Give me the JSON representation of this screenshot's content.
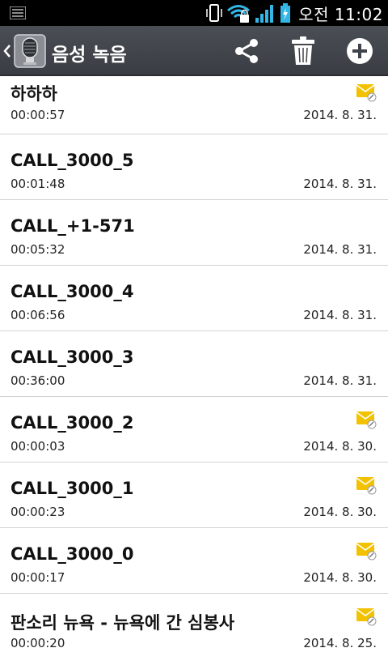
{
  "status_bar": {
    "time": "오전 11:02",
    "icons": [
      "notification-icon",
      "phone-vibrate-icon",
      "wifi-icon",
      "signal-icon",
      "battery-charging-icon"
    ]
  },
  "action_bar": {
    "title": "음성 녹음",
    "icons": [
      "back-chevron-icon",
      "voice-recorder-app-icon",
      "share-icon",
      "trash-icon",
      "add-icon"
    ]
  },
  "recordings": [
    {
      "title": "하하하",
      "duration": "00:00:57",
      "date": "2014. 8. 31.",
      "has_memo": true
    },
    {
      "title": "CALL_3000_5",
      "duration": "00:01:48",
      "date": "2014. 8. 31.",
      "has_memo": false
    },
    {
      "title": "CALL_+1-571",
      "duration": "00:05:32",
      "date": "2014. 8. 31.",
      "has_memo": false
    },
    {
      "title": "CALL_3000_4",
      "duration": "00:06:56",
      "date": "2014. 8. 31.",
      "has_memo": false
    },
    {
      "title": "CALL_3000_3",
      "duration": "00:36:00",
      "date": "2014. 8. 31.",
      "has_memo": false
    },
    {
      "title": "CALL_3000_2",
      "duration": "00:00:03",
      "date": "2014. 8. 30.",
      "has_memo": true
    },
    {
      "title": "CALL_3000_1",
      "duration": "00:00:23",
      "date": "2014. 8. 30.",
      "has_memo": true
    },
    {
      "title": "CALL_3000_0",
      "duration": "00:00:17",
      "date": "2014. 8. 30.",
      "has_memo": true
    },
    {
      "title": "판소리 뉴욕 - 뉴욕에 간 심봉사",
      "duration": "00:00:20",
      "date": "2014. 8. 25.",
      "has_memo": true
    }
  ],
  "colors": {
    "status_bar_bg": "#000000",
    "action_bar_bg": "#3f434a",
    "status_icon_accent": "#33b5e5",
    "memo_icon": "#f2c200",
    "divider": "#d2d2d2"
  }
}
